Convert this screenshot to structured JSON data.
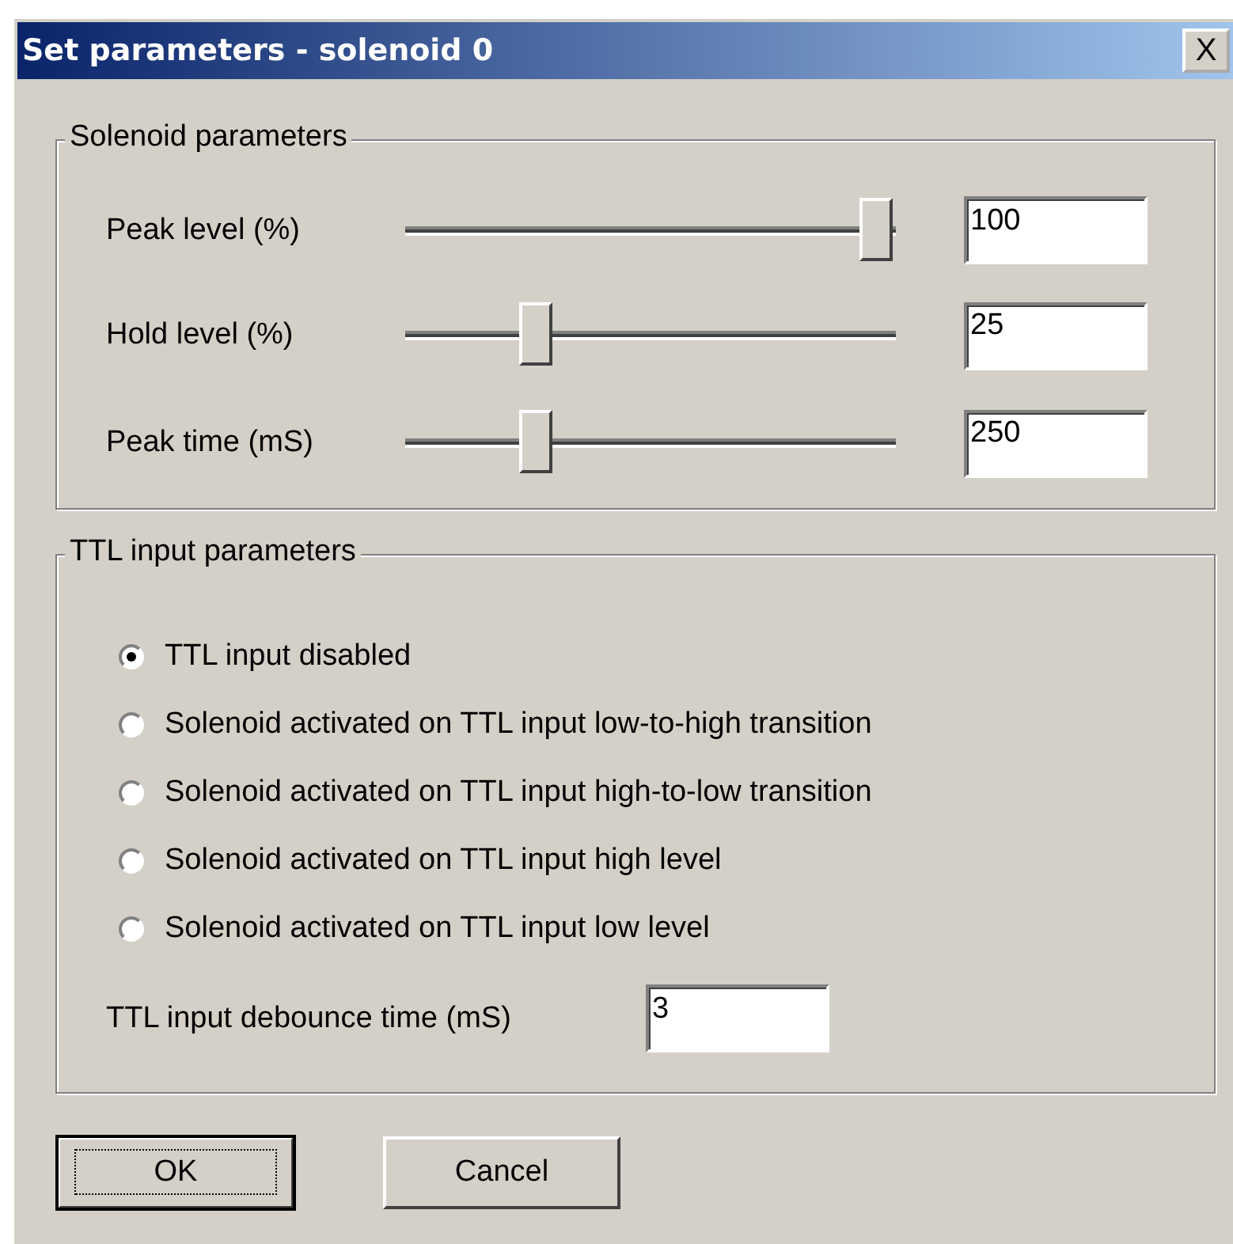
{
  "window": {
    "title": "Set parameters - solenoid 0",
    "close": "X"
  },
  "solenoid_group": {
    "title": "Solenoid parameters",
    "rows": [
      {
        "label": "Peak level (%)",
        "level": 1.0,
        "value": "100"
      },
      {
        "label": "Hold level (%)",
        "level": 0.25,
        "value": "25"
      },
      {
        "label": "Peak time (mS)",
        "level": 0.25,
        "value": "250"
      }
    ]
  },
  "ttl_group": {
    "title": "TTL input parameters",
    "options": [
      {
        "label": "TTL input disabled",
        "selected": true
      },
      {
        "label": "Solenoid activated on TTL input low-to-high transition",
        "selected": false
      },
      {
        "label": "Solenoid activated on TTL input high-to-low transition",
        "selected": false
      },
      {
        "label": "Solenoid activated on TTL input high level",
        "selected": false
      },
      {
        "label": "Solenoid activated on TTL input low level",
        "selected": false
      }
    ],
    "debounce": {
      "label": "TTL input debounce time (mS)",
      "value": "3"
    }
  },
  "buttons": [
    {
      "label": "OK",
      "default": true
    },
    {
      "label": "Cancel",
      "default": false
    }
  ]
}
